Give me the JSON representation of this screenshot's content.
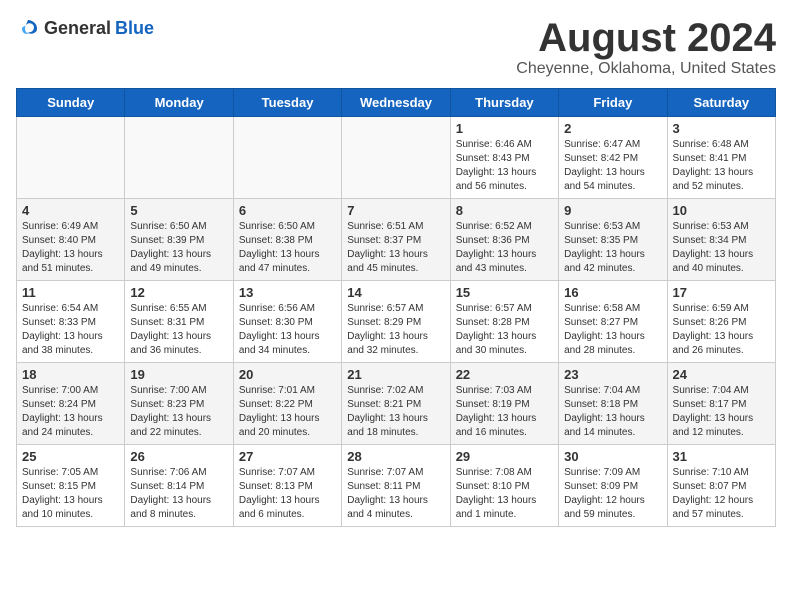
{
  "header": {
    "logo_general": "General",
    "logo_blue": "Blue",
    "main_title": "August 2024",
    "sub_title": "Cheyenne, Oklahoma, United States"
  },
  "days_of_week": [
    "Sunday",
    "Monday",
    "Tuesday",
    "Wednesday",
    "Thursday",
    "Friday",
    "Saturday"
  ],
  "weeks": [
    [
      {
        "day": "",
        "info": ""
      },
      {
        "day": "",
        "info": ""
      },
      {
        "day": "",
        "info": ""
      },
      {
        "day": "",
        "info": ""
      },
      {
        "day": "1",
        "info": "Sunrise: 6:46 AM\nSunset: 8:43 PM\nDaylight: 13 hours\nand 56 minutes."
      },
      {
        "day": "2",
        "info": "Sunrise: 6:47 AM\nSunset: 8:42 PM\nDaylight: 13 hours\nand 54 minutes."
      },
      {
        "day": "3",
        "info": "Sunrise: 6:48 AM\nSunset: 8:41 PM\nDaylight: 13 hours\nand 52 minutes."
      }
    ],
    [
      {
        "day": "4",
        "info": "Sunrise: 6:49 AM\nSunset: 8:40 PM\nDaylight: 13 hours\nand 51 minutes."
      },
      {
        "day": "5",
        "info": "Sunrise: 6:50 AM\nSunset: 8:39 PM\nDaylight: 13 hours\nand 49 minutes."
      },
      {
        "day": "6",
        "info": "Sunrise: 6:50 AM\nSunset: 8:38 PM\nDaylight: 13 hours\nand 47 minutes."
      },
      {
        "day": "7",
        "info": "Sunrise: 6:51 AM\nSunset: 8:37 PM\nDaylight: 13 hours\nand 45 minutes."
      },
      {
        "day": "8",
        "info": "Sunrise: 6:52 AM\nSunset: 8:36 PM\nDaylight: 13 hours\nand 43 minutes."
      },
      {
        "day": "9",
        "info": "Sunrise: 6:53 AM\nSunset: 8:35 PM\nDaylight: 13 hours\nand 42 minutes."
      },
      {
        "day": "10",
        "info": "Sunrise: 6:53 AM\nSunset: 8:34 PM\nDaylight: 13 hours\nand 40 minutes."
      }
    ],
    [
      {
        "day": "11",
        "info": "Sunrise: 6:54 AM\nSunset: 8:33 PM\nDaylight: 13 hours\nand 38 minutes."
      },
      {
        "day": "12",
        "info": "Sunrise: 6:55 AM\nSunset: 8:31 PM\nDaylight: 13 hours\nand 36 minutes."
      },
      {
        "day": "13",
        "info": "Sunrise: 6:56 AM\nSunset: 8:30 PM\nDaylight: 13 hours\nand 34 minutes."
      },
      {
        "day": "14",
        "info": "Sunrise: 6:57 AM\nSunset: 8:29 PM\nDaylight: 13 hours\nand 32 minutes."
      },
      {
        "day": "15",
        "info": "Sunrise: 6:57 AM\nSunset: 8:28 PM\nDaylight: 13 hours\nand 30 minutes."
      },
      {
        "day": "16",
        "info": "Sunrise: 6:58 AM\nSunset: 8:27 PM\nDaylight: 13 hours\nand 28 minutes."
      },
      {
        "day": "17",
        "info": "Sunrise: 6:59 AM\nSunset: 8:26 PM\nDaylight: 13 hours\nand 26 minutes."
      }
    ],
    [
      {
        "day": "18",
        "info": "Sunrise: 7:00 AM\nSunset: 8:24 PM\nDaylight: 13 hours\nand 24 minutes."
      },
      {
        "day": "19",
        "info": "Sunrise: 7:00 AM\nSunset: 8:23 PM\nDaylight: 13 hours\nand 22 minutes."
      },
      {
        "day": "20",
        "info": "Sunrise: 7:01 AM\nSunset: 8:22 PM\nDaylight: 13 hours\nand 20 minutes."
      },
      {
        "day": "21",
        "info": "Sunrise: 7:02 AM\nSunset: 8:21 PM\nDaylight: 13 hours\nand 18 minutes."
      },
      {
        "day": "22",
        "info": "Sunrise: 7:03 AM\nSunset: 8:19 PM\nDaylight: 13 hours\nand 16 minutes."
      },
      {
        "day": "23",
        "info": "Sunrise: 7:04 AM\nSunset: 8:18 PM\nDaylight: 13 hours\nand 14 minutes."
      },
      {
        "day": "24",
        "info": "Sunrise: 7:04 AM\nSunset: 8:17 PM\nDaylight: 13 hours\nand 12 minutes."
      }
    ],
    [
      {
        "day": "25",
        "info": "Sunrise: 7:05 AM\nSunset: 8:15 PM\nDaylight: 13 hours\nand 10 minutes."
      },
      {
        "day": "26",
        "info": "Sunrise: 7:06 AM\nSunset: 8:14 PM\nDaylight: 13 hours\nand 8 minutes."
      },
      {
        "day": "27",
        "info": "Sunrise: 7:07 AM\nSunset: 8:13 PM\nDaylight: 13 hours\nand 6 minutes."
      },
      {
        "day": "28",
        "info": "Sunrise: 7:07 AM\nSunset: 8:11 PM\nDaylight: 13 hours\nand 4 minutes."
      },
      {
        "day": "29",
        "info": "Sunrise: 7:08 AM\nSunset: 8:10 PM\nDaylight: 13 hours\nand 1 minute."
      },
      {
        "day": "30",
        "info": "Sunrise: 7:09 AM\nSunset: 8:09 PM\nDaylight: 12 hours\nand 59 minutes."
      },
      {
        "day": "31",
        "info": "Sunrise: 7:10 AM\nSunset: 8:07 PM\nDaylight: 12 hours\nand 57 minutes."
      }
    ]
  ]
}
